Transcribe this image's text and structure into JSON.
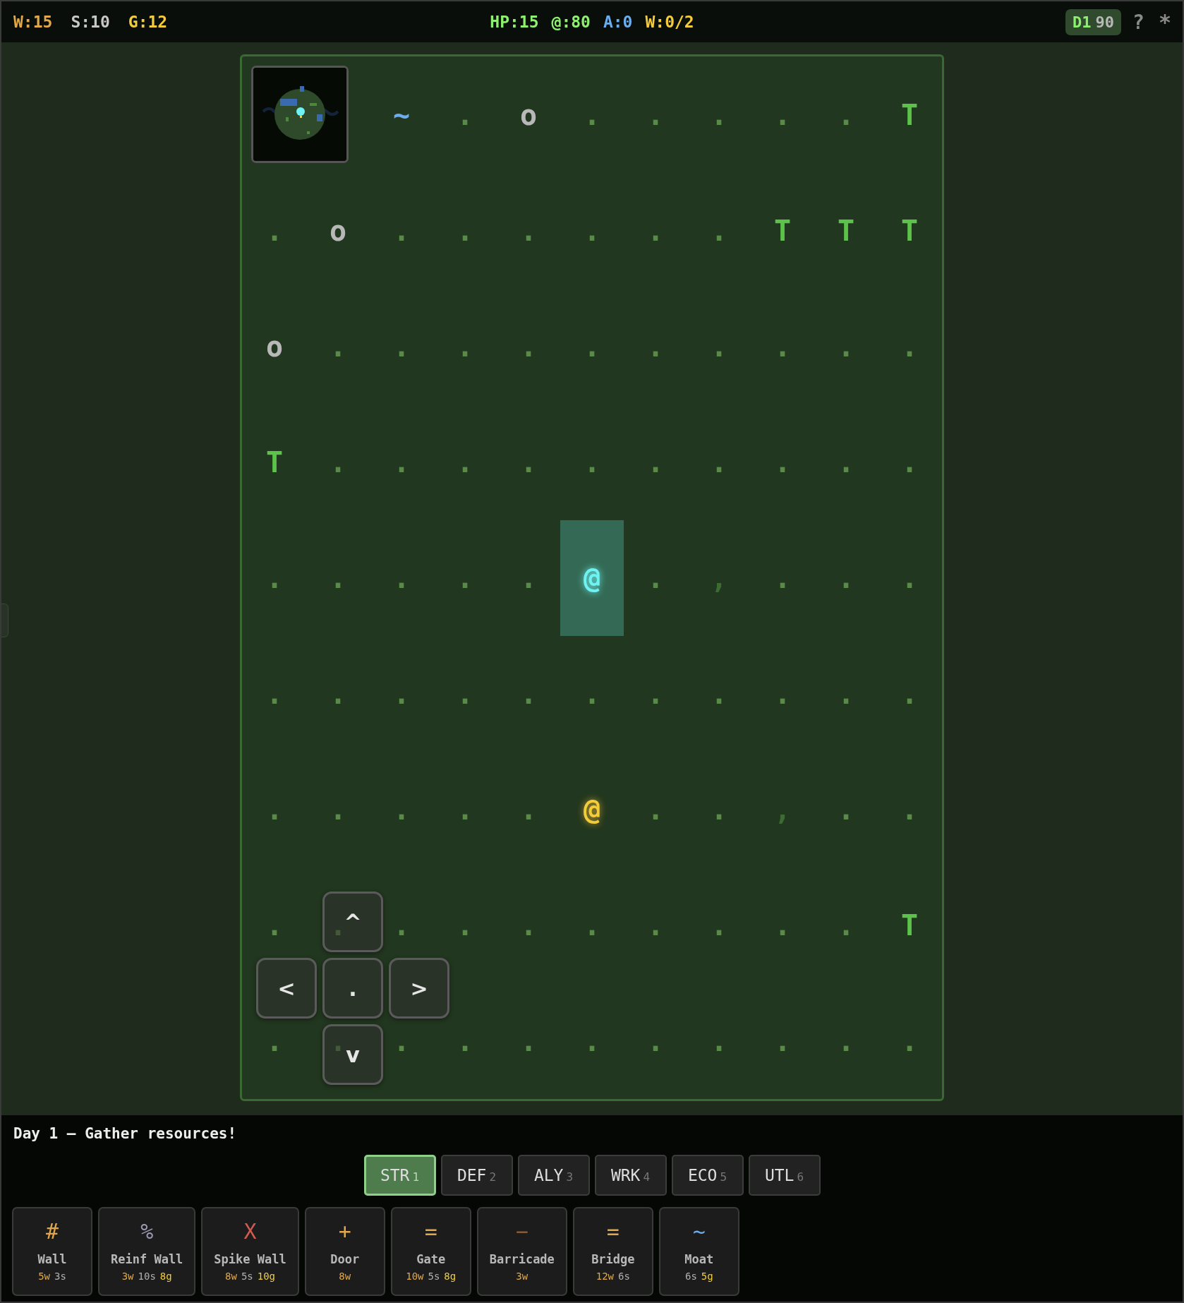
{
  "resources": [
    {
      "text": "W:15",
      "color": "#e0a84a"
    },
    {
      "text": "S:10",
      "color": "#c8c8c8"
    },
    {
      "text": "G:12",
      "color": "#f2cc3a"
    }
  ],
  "stats": [
    {
      "text": "HP:15",
      "color": "#8ef070"
    },
    {
      "text": "@:80",
      "color": "#8ef070"
    },
    {
      "text": "A:0",
      "color": "#6aaef0"
    },
    {
      "text": "W:0/2",
      "color": "#f2cc3a"
    }
  ],
  "day_badge": {
    "day": "D1",
    "count": "90"
  },
  "header_icons": [
    {
      "text": "?",
      "kind": "help"
    },
    {
      "text": "*",
      "kind": "settings"
    }
  ],
  "map": {
    "rows": [
      [
        {
          "kind": "covered"
        },
        {
          "kind": "covered"
        },
        {
          "glyph": "~",
          "kind": "water"
        },
        {
          "glyph": ".",
          "kind": "floor"
        },
        {
          "glyph": "o",
          "kind": "rock"
        },
        {
          "glyph": ".",
          "kind": "floor"
        },
        {
          "glyph": ".",
          "kind": "floor"
        },
        {
          "glyph": ".",
          "kind": "floor"
        },
        {
          "glyph": ".",
          "kind": "floor"
        },
        {
          "glyph": ".",
          "kind": "floor"
        },
        {
          "glyph": "T",
          "kind": "tree"
        }
      ],
      [
        {
          "glyph": ".",
          "kind": "floor"
        },
        {
          "glyph": "o",
          "kind": "rock"
        },
        {
          "glyph": ".",
          "kind": "floor"
        },
        {
          "glyph": ".",
          "kind": "floor"
        },
        {
          "glyph": ".",
          "kind": "floor"
        },
        {
          "glyph": ".",
          "kind": "floor"
        },
        {
          "glyph": ".",
          "kind": "floor"
        },
        {
          "glyph": ".",
          "kind": "floor"
        },
        {
          "glyph": "T",
          "kind": "tree"
        },
        {
          "glyph": "T",
          "kind": "tree"
        },
        {
          "glyph": "T",
          "kind": "tree"
        }
      ],
      [
        {
          "glyph": "o",
          "kind": "rock"
        },
        {
          "glyph": ".",
          "kind": "floor"
        },
        {
          "glyph": ".",
          "kind": "floor"
        },
        {
          "glyph": ".",
          "kind": "floor"
        },
        {
          "glyph": ".",
          "kind": "floor"
        },
        {
          "glyph": ".",
          "kind": "floor"
        },
        {
          "glyph": ".",
          "kind": "floor"
        },
        {
          "glyph": ".",
          "kind": "floor"
        },
        {
          "glyph": ".",
          "kind": "floor"
        },
        {
          "glyph": ".",
          "kind": "floor"
        },
        {
          "glyph": ".",
          "kind": "floor"
        }
      ],
      [
        {
          "glyph": "T",
          "kind": "tree"
        },
        {
          "glyph": ".",
          "kind": "floor"
        },
        {
          "glyph": ".",
          "kind": "floor"
        },
        {
          "glyph": ".",
          "kind": "floor"
        },
        {
          "glyph": ".",
          "kind": "floor"
        },
        {
          "glyph": ".",
          "kind": "floor"
        },
        {
          "glyph": ".",
          "kind": "floor"
        },
        {
          "glyph": ".",
          "kind": "floor"
        },
        {
          "glyph": ".",
          "kind": "floor"
        },
        {
          "glyph": ".",
          "kind": "floor"
        },
        {
          "glyph": ".",
          "kind": "floor"
        }
      ],
      [
        {
          "glyph": ".",
          "kind": "floor"
        },
        {
          "glyph": ".",
          "kind": "floor"
        },
        {
          "glyph": ".",
          "kind": "floor"
        },
        {
          "glyph": ".",
          "kind": "floor"
        },
        {
          "glyph": ".",
          "kind": "floor"
        },
        {
          "glyph": "@",
          "kind": "player"
        },
        {
          "glyph": ".",
          "kind": "floor"
        },
        {
          "glyph": ",",
          "kind": "grass"
        },
        {
          "glyph": ".",
          "kind": "floor"
        },
        {
          "glyph": ".",
          "kind": "floor"
        },
        {
          "glyph": ".",
          "kind": "floor"
        }
      ],
      [
        {
          "glyph": ".",
          "kind": "floor"
        },
        {
          "glyph": ".",
          "kind": "floor"
        },
        {
          "glyph": ".",
          "kind": "floor"
        },
        {
          "glyph": ".",
          "kind": "floor"
        },
        {
          "glyph": ".",
          "kind": "floor"
        },
        {
          "glyph": ".",
          "kind": "floor"
        },
        {
          "glyph": ".",
          "kind": "floor"
        },
        {
          "glyph": ".",
          "kind": "floor"
        },
        {
          "glyph": ".",
          "kind": "floor"
        },
        {
          "glyph": ".",
          "kind": "floor"
        },
        {
          "glyph": ".",
          "kind": "floor"
        }
      ],
      [
        {
          "glyph": ".",
          "kind": "floor"
        },
        {
          "glyph": ".",
          "kind": "floor"
        },
        {
          "glyph": ".",
          "kind": "floor"
        },
        {
          "glyph": ".",
          "kind": "floor"
        },
        {
          "glyph": ".",
          "kind": "floor"
        },
        {
          "glyph": "@",
          "kind": "ally"
        },
        {
          "glyph": ".",
          "kind": "floor"
        },
        {
          "glyph": ".",
          "kind": "floor"
        },
        {
          "glyph": ",",
          "kind": "grass"
        },
        {
          "glyph": ".",
          "kind": "floor"
        },
        {
          "glyph": ".",
          "kind": "floor"
        }
      ],
      [
        {
          "glyph": ".",
          "kind": "floor"
        },
        {
          "glyph": ".",
          "kind": "floor"
        },
        {
          "glyph": ".",
          "kind": "floor"
        },
        {
          "glyph": ".",
          "kind": "floor"
        },
        {
          "glyph": ".",
          "kind": "floor"
        },
        {
          "glyph": ".",
          "kind": "floor"
        },
        {
          "glyph": ".",
          "kind": "floor"
        },
        {
          "glyph": ".",
          "kind": "floor"
        },
        {
          "glyph": ".",
          "kind": "floor"
        },
        {
          "glyph": ".",
          "kind": "floor"
        },
        {
          "glyph": "T",
          "kind": "tree"
        }
      ],
      [
        {
          "glyph": ".",
          "kind": "floor"
        },
        {
          "glyph": ".",
          "kind": "floor"
        },
        {
          "glyph": ".",
          "kind": "floor"
        },
        {
          "glyph": ".",
          "kind": "floor"
        },
        {
          "glyph": ".",
          "kind": "floor"
        },
        {
          "glyph": ".",
          "kind": "floor"
        },
        {
          "glyph": ".",
          "kind": "floor"
        },
        {
          "glyph": ".",
          "kind": "floor"
        },
        {
          "glyph": ".",
          "kind": "floor"
        },
        {
          "glyph": ".",
          "kind": "floor"
        },
        {
          "glyph": ".",
          "kind": "floor"
        }
      ]
    ]
  },
  "dpad": {
    "up": "^",
    "left": "<",
    "center": ".",
    "right": ">",
    "down": "v"
  },
  "message": "Day 1 – Gather resources!",
  "tabs": [
    {
      "label": "STR",
      "key": "1",
      "selected": true
    },
    {
      "label": "DEF",
      "key": "2",
      "selected": false
    },
    {
      "label": "ALY",
      "key": "3",
      "selected": false
    },
    {
      "label": "WRK",
      "key": "4",
      "selected": false
    },
    {
      "label": "ECO",
      "key": "5",
      "selected": false
    },
    {
      "label": "UTL",
      "key": "6",
      "selected": false
    }
  ],
  "builds": [
    {
      "icon": "#",
      "color": "#e0a84a",
      "name": "Wall",
      "costs": [
        {
          "text": "5w",
          "kind": "wood"
        },
        {
          "text": "3s",
          "kind": "stone"
        }
      ]
    },
    {
      "icon": "%",
      "color": "#9a98b0",
      "name": "Reinf Wall",
      "costs": [
        {
          "text": "3w",
          "kind": "wood"
        },
        {
          "text": "10s",
          "kind": "stone"
        },
        {
          "text": "8g",
          "kind": "gold"
        }
      ]
    },
    {
      "icon": "X",
      "color": "#d05a50",
      "name": "Spike Wall",
      "costs": [
        {
          "text": "8w",
          "kind": "wood"
        },
        {
          "text": "5s",
          "kind": "stone"
        },
        {
          "text": "10g",
          "kind": "gold"
        }
      ]
    },
    {
      "icon": "+",
      "color": "#e0a84a",
      "name": "Door",
      "costs": [
        {
          "text": "8w",
          "kind": "wood"
        }
      ]
    },
    {
      "icon": "=",
      "color": "#e0a84a",
      "name": "Gate",
      "costs": [
        {
          "text": "10w",
          "kind": "wood"
        },
        {
          "text": "5s",
          "kind": "stone"
        },
        {
          "text": "8g",
          "kind": "gold"
        }
      ]
    },
    {
      "icon": "−",
      "color": "#8a5a38",
      "name": "Barricade",
      "costs": [
        {
          "text": "3w",
          "kind": "wood"
        }
      ]
    },
    {
      "icon": "=",
      "color": "#e0a84a",
      "name": "Bridge",
      "costs": [
        {
          "text": "12w",
          "kind": "wood"
        },
        {
          "text": "6s",
          "kind": "stone"
        }
      ]
    },
    {
      "icon": "~",
      "color": "#6aaef0",
      "name": "Moat",
      "costs": [
        {
          "text": "6s",
          "kind": "stone"
        },
        {
          "text": "5g",
          "kind": "gold"
        }
      ]
    }
  ]
}
